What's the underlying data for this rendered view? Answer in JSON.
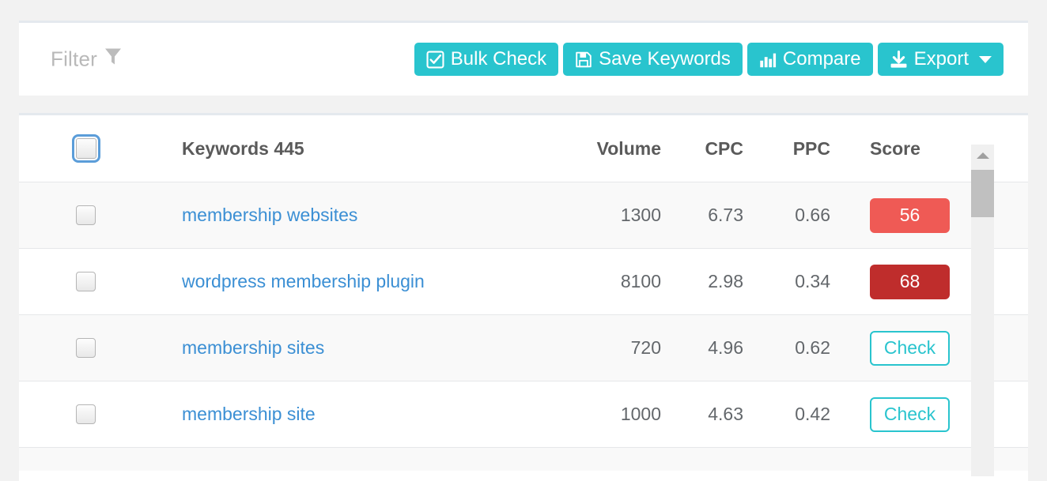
{
  "toolbar": {
    "filter_label": "Filter",
    "filter_icon": "funnel-icon",
    "buttons": [
      {
        "label": "Bulk Check",
        "icon": "check-square-icon"
      },
      {
        "label": "Save Keywords",
        "icon": "save-floppy-icon"
      },
      {
        "label": "Compare",
        "icon": "bar-chart-icon"
      },
      {
        "label": "Export",
        "icon": "download-icon",
        "caret": true
      }
    ],
    "accent_color": "#29c4ce"
  },
  "table": {
    "headers": {
      "keywords": "Keywords 445",
      "volume": "Volume",
      "cpc": "CPC",
      "ppc": "PPC",
      "score": "Score"
    },
    "rows": [
      {
        "keyword": "membership websites",
        "volume": "1300",
        "cpc": "6.73",
        "ppc": "0.66",
        "score": "56",
        "score_state": "scored",
        "score_color": "#ef5a55"
      },
      {
        "keyword": "wordpress membership plugin",
        "volume": "8100",
        "cpc": "2.98",
        "ppc": "0.34",
        "score": "68",
        "score_state": "scored",
        "score_color": "#bf2d2c"
      },
      {
        "keyword": "membership sites",
        "volume": "720",
        "cpc": "4.96",
        "ppc": "0.62",
        "score": "Check",
        "score_state": "unchecked",
        "score_color": "#29c4ce"
      },
      {
        "keyword": "membership site",
        "volume": "1000",
        "cpc": "4.63",
        "ppc": "0.42",
        "score": "Check",
        "score_state": "unchecked",
        "score_color": "#29c4ce"
      }
    ]
  },
  "scrollbar": {
    "up_arrow_icon": "triangle-up-icon",
    "thumb_color": "#c0c0c0"
  }
}
